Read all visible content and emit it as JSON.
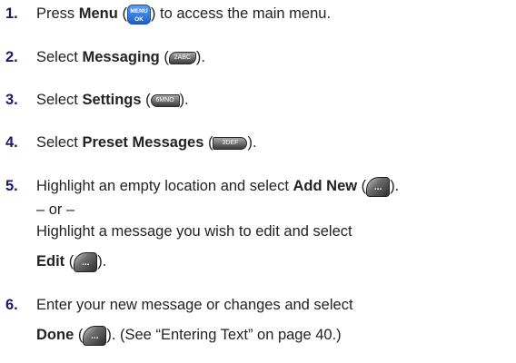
{
  "steps": [
    {
      "num": "1.",
      "pre": "Press ",
      "bold": "Menu",
      "post_open": " (",
      "key": "MENU OK",
      "post": ") to access the main menu."
    },
    {
      "num": "2.",
      "pre": "Select ",
      "bold": "Messaging",
      "post_open": " (",
      "key": "2ABC",
      "post": ")."
    },
    {
      "num": "3.",
      "pre": "Select ",
      "bold": "Settings",
      "post_open": " (",
      "key": "6MNO",
      "post": ")."
    },
    {
      "num": "4.",
      "pre": "Select ",
      "bold": "Preset Messages",
      "post_open": " (",
      "key": "3DEF",
      "post": ")."
    },
    {
      "num": "5.",
      "pre": "Highlight an empty location and select ",
      "bold": "Add New",
      "post_open": " (",
      "key": "...",
      "post": ").",
      "or": "– or –",
      "line3": "Highlight a message you wish to edit and select",
      "bold2": "Edit",
      "post2_open": " (",
      "post2": ")."
    },
    {
      "num": "6.",
      "pre": "Enter your new message or changes and select",
      "bold2": "Done",
      "post2_open": " (",
      "key": "...",
      "post2": "). (See “Entering Text” on page 40.)"
    }
  ]
}
